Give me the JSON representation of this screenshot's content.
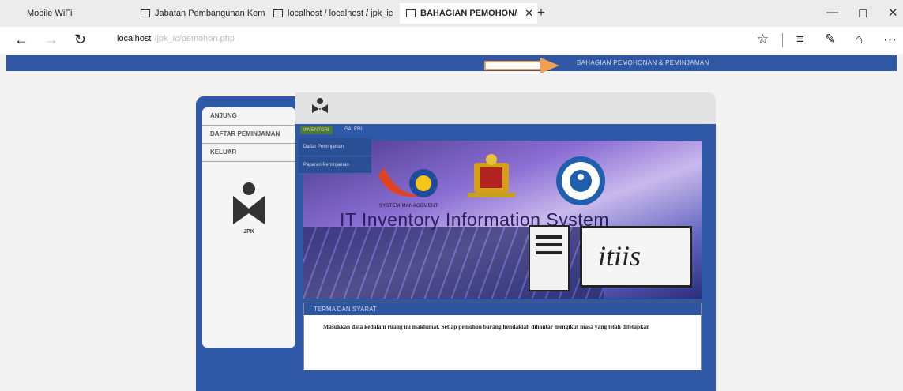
{
  "browser": {
    "tabs": [
      {
        "label": "Mobile WiFi",
        "active": false
      },
      {
        "label": "Jabatan Pembangunan Kem",
        "active": false
      },
      {
        "label": "localhost / localhost / jpk_ic",
        "active": false
      },
      {
        "label": "BAHAGIAN PEMOHON/",
        "active": true
      }
    ],
    "new_tab": "+",
    "window_controls": {
      "minimize": "—",
      "maximize": "◻",
      "close": "✕"
    },
    "nav": {
      "back": "←",
      "forward": "→",
      "refresh": "↻"
    },
    "url": {
      "host": "localhost",
      "path": "/jpk_ic/pemohon.php"
    },
    "tools": {
      "favorite": "☆",
      "reading_list": "≡",
      "notes": "✎",
      "share": "⌂",
      "more": "···"
    }
  },
  "page": {
    "strip_title": "BAHAGIAN PEMOHONAN & PEMINJAMAN",
    "sidebar": {
      "items": [
        "ANJUNG",
        "DAFTAR PEMINJAMAN",
        "KELUAR"
      ],
      "logo_text": "JPK"
    },
    "menu": {
      "items": [
        "INVENTORI",
        "GALERI"
      ],
      "dropdown": [
        "Daftar Peminjaman",
        "Paparan Peminjaman"
      ]
    },
    "banner": {
      "title": "IT Inventory Information System",
      "subtitle": "SYSTEM MANAGEMENT",
      "brand": "itiis"
    },
    "terms": {
      "heading": "TERMA DAN SYARAT",
      "body": "Masukkan data kedalam ruang ini maklumat. Setiap pemohon barang hendaklah dihantar mengikut masa yang telah ditetapkan"
    },
    "colors": {
      "primary": "#2f58a6",
      "menu_active": "#4a7b3a",
      "arrow": "#f0a050"
    }
  }
}
